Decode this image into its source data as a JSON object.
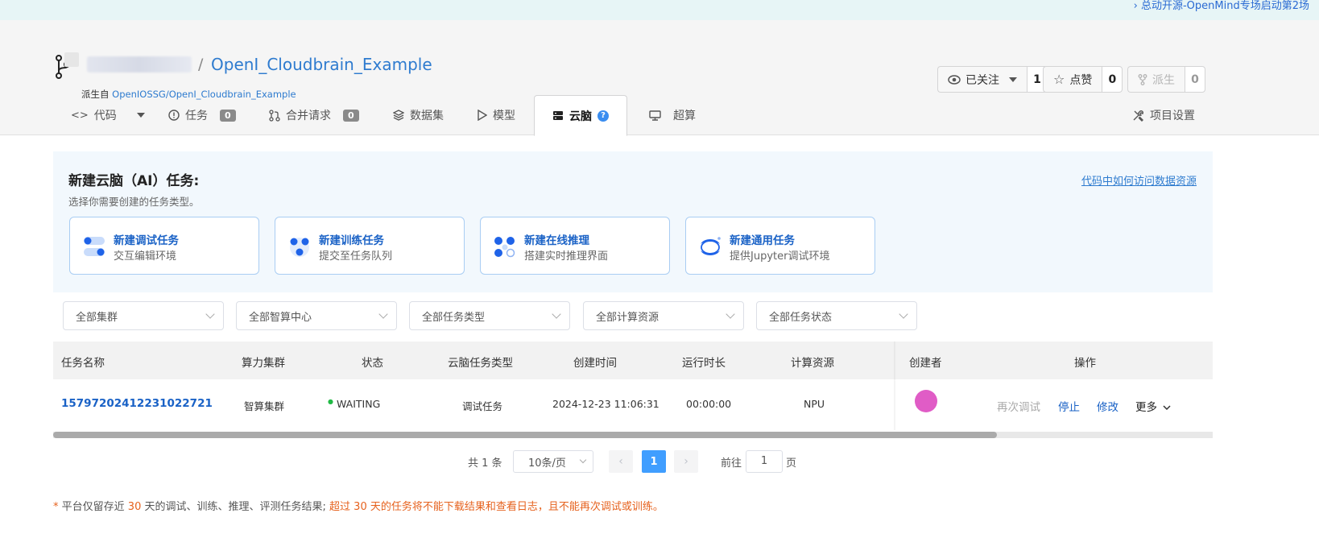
{
  "banner": {
    "link_text": "› 总动开源-OpenMind专场启动第2场"
  },
  "repo": {
    "separator": "/",
    "name": "OpenI_Cloudbrain_Example",
    "forked_prefix": "派生自",
    "forked_from": "OpenIOSSG/OpenI_Cloudbrain_Example"
  },
  "actions": {
    "watch": {
      "label": "已关注",
      "count": "1"
    },
    "star": {
      "label": "点赞",
      "count": "0"
    },
    "fork": {
      "label": "派生",
      "count": "0"
    }
  },
  "tabs": {
    "code": "代码",
    "issues": {
      "label": "任务",
      "count": "0"
    },
    "pulls": {
      "label": "合并请求",
      "count": "0"
    },
    "datasets": "数据集",
    "models": "模型",
    "cloudbrain": "云脑",
    "supercompute": "超算",
    "settings": "项目设置"
  },
  "create_panel": {
    "title": "新建云脑（AI）任务:",
    "subtitle": "选择你需要创建的任务类型。",
    "help_link": "代码中如何访问数据资源",
    "cards": [
      {
        "title": "新建调试任务",
        "desc": "交互编辑环境"
      },
      {
        "title": "新建训练任务",
        "desc": "提交至任务队列"
      },
      {
        "title": "新建在线推理",
        "desc": "搭建实时推理界面"
      },
      {
        "title": "新建通用任务",
        "desc": "提供Jupyter调试环境"
      }
    ]
  },
  "filters": {
    "cluster": "全部集群",
    "center": "全部智算中心",
    "task_type": "全部任务类型",
    "resource": "全部计算资源",
    "status": "全部任务状态"
  },
  "table": {
    "headers": {
      "name": "任务名称",
      "cluster": "算力集群",
      "status": "状态",
      "type": "云脑任务类型",
      "created": "创建时间",
      "duration": "运行时长",
      "resource": "计算资源",
      "creator": "创建者",
      "ops": "操作"
    },
    "rows": [
      {
        "name": "15797202412231022721",
        "cluster": "智算集群",
        "status": "WAITING",
        "type": "调试任务",
        "created": "2024-12-23 11:06:31",
        "duration": "00:00:00",
        "resource": "NPU",
        "ops": {
          "rerun": "再次调试",
          "stop": "停止",
          "edit": "修改",
          "more": "更多"
        }
      }
    ]
  },
  "pagination": {
    "total": "共 1 条",
    "page_size": "10条/页",
    "current": "1",
    "goto_label": "前往",
    "goto_value": "1",
    "unit": "页"
  },
  "note": {
    "star": "*",
    "part1": "平台仅留存近",
    "days1": "30",
    "part2": "天的调试、训练、推理、评测任务结果;",
    "part3": "超过",
    "days2": "30",
    "part4": "天的任务将不能下载结果和查看日志，且不能再次调试或训练。"
  },
  "colors": {
    "link": "#2e7bcf",
    "primary": "#409eff",
    "warning": "#e6621e",
    "avatar": "#e05cc6"
  }
}
